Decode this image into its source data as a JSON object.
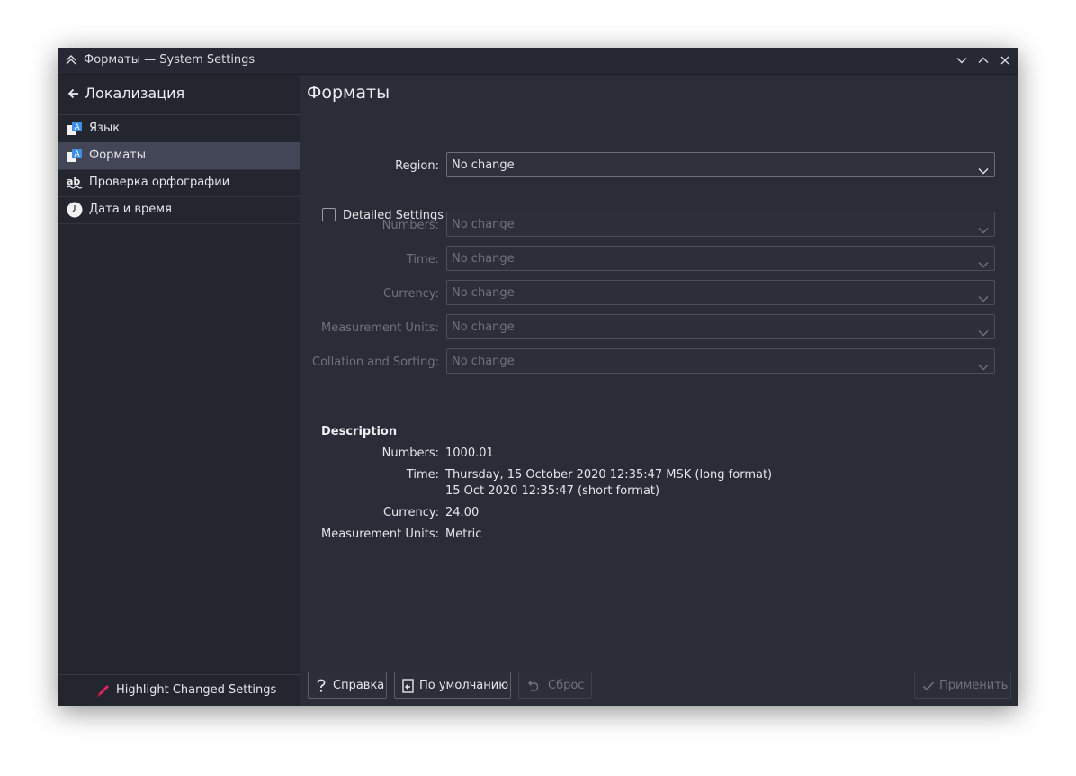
{
  "window": {
    "title": "Форматы — System Settings"
  },
  "sidebar": {
    "back_label": "Локализация",
    "items": [
      {
        "label": "Язык",
        "icon": "language-icon",
        "selected": false
      },
      {
        "label": "Форматы",
        "icon": "formats-icon",
        "selected": true
      },
      {
        "label": "Проверка орфографии",
        "icon": "spellcheck-icon",
        "selected": false
      },
      {
        "label": "Дата и время",
        "icon": "clock-icon",
        "selected": false
      }
    ],
    "footer_label": "Highlight Changed Settings"
  },
  "main": {
    "title": "Форматы",
    "region": {
      "label": "Region:",
      "value": "No change"
    },
    "detailed_settings": {
      "label": "Detailed Settings",
      "checked": false
    },
    "fields": [
      {
        "label": "Numbers:",
        "value": "No change"
      },
      {
        "label": "Time:",
        "value": "No change"
      },
      {
        "label": "Currency:",
        "value": "No change"
      },
      {
        "label": "Measurement Units:",
        "value": "No change"
      },
      {
        "label": "Collation and Sorting:",
        "value": "No change"
      }
    ],
    "description": {
      "title": "Description",
      "rows": [
        {
          "label": "Numbers:",
          "value": "1000.01"
        },
        {
          "label": "Time:",
          "value": "Thursday, 15 October 2020 12:35:47 MSK (long format)",
          "value2": "15 Oct 2020 12:35:47 (short format)"
        },
        {
          "label": "Currency:",
          "value": "24.00"
        },
        {
          "label": "Measurement Units:",
          "value": "Metric"
        }
      ]
    }
  },
  "buttons": {
    "help": "Справка",
    "defaults": "По умолчанию",
    "reset": "Сброс",
    "apply": "Применить"
  },
  "colors": {
    "window_bg": "#2a2c37",
    "sidebar_bg": "#23252f",
    "selected_bg": "#434656",
    "accent_pen": "#e0245e",
    "icon_blue": "#3d8ee6"
  }
}
